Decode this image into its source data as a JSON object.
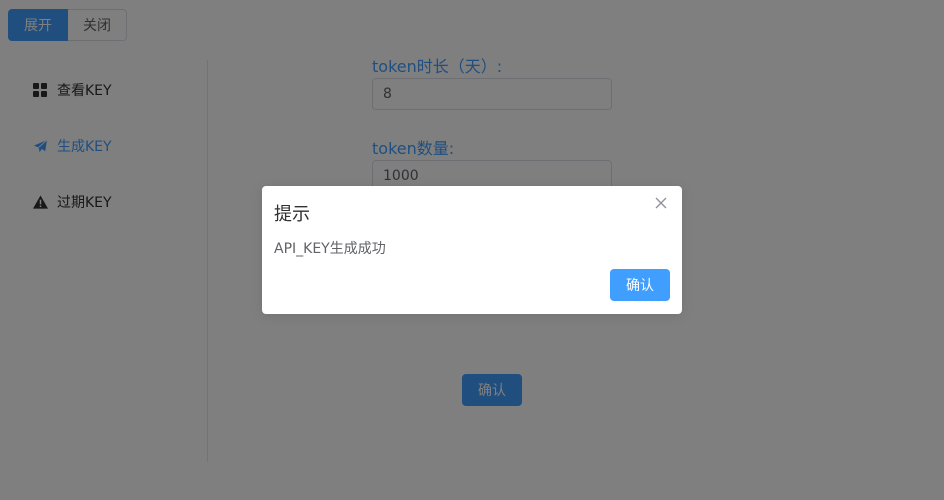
{
  "toolbar": {
    "expand_label": "展开",
    "close_label": "关闭"
  },
  "sidebar": {
    "items": [
      {
        "label": "查看KEY",
        "icon": "grid-icon"
      },
      {
        "label": "生成KEY",
        "icon": "paper-plane-icon",
        "active": true
      },
      {
        "label": "过期KEY",
        "icon": "warning-icon"
      }
    ]
  },
  "form": {
    "duration_label": "token时长（天）:",
    "duration_value": "8",
    "count_label": "token数量:",
    "count_value": "1000",
    "submit_label": "确认"
  },
  "dialog": {
    "title": "提示",
    "message": "API_KEY生成成功",
    "confirm_label": "确认"
  },
  "colors": {
    "primary": "#409eff",
    "overlay": "rgba(0,0,0,0.5)"
  }
}
